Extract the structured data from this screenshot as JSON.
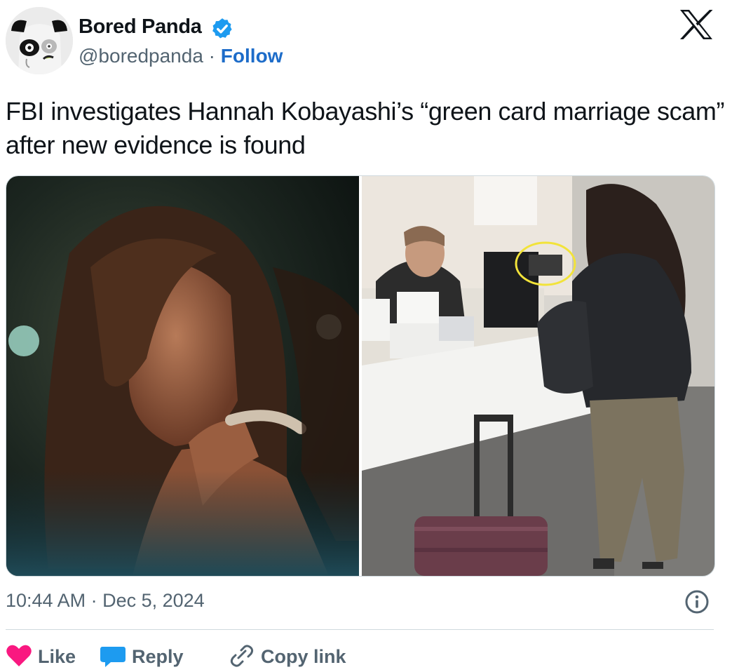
{
  "author": {
    "display_name": "Bored Panda",
    "handle": "@boredpanda",
    "separator": " · ",
    "follow_label": "Follow"
  },
  "tweet": {
    "text": "FBI investigates Hannah Kobayashi’s “green card marriage scam” after new evidence is found",
    "timestamp": "10:44 AM · Dec 5, 2024"
  },
  "actions": {
    "like_label": "Like",
    "reply_label": "Reply",
    "copy_link_label": "Copy link"
  },
  "icons": {
    "verified": "verified-badge-icon",
    "platform": "x-logo-icon",
    "info": "info-icon",
    "like": "heart-icon",
    "reply": "reply-bubble-icon",
    "copy": "link-icon"
  },
  "colors": {
    "text": "#0f1419",
    "secondary": "#536471",
    "link": "#1d6cc9",
    "verified": "#1d9bf0",
    "like": "#f91880",
    "highlight_circle": "#f2e33a"
  }
}
